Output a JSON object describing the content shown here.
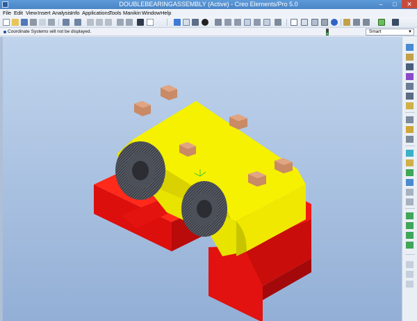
{
  "window": {
    "title": "DOUBLEBEARINGASSEMBLY (Active) - Creo Elements/Pro 5.0",
    "minimize": "–",
    "maximize": "□",
    "close": "✕"
  },
  "menu": [
    "File",
    "Edit",
    "View",
    "Insert",
    "Analysis",
    "Info",
    "Applications",
    "Tools",
    "Manikin",
    "Window",
    "Help"
  ],
  "status": {
    "message": "Coordinate Systems will not be displayed.",
    "filter_value": "Smart",
    "filter_arrow": "▼"
  },
  "toolbar_icons": [
    "new-icon",
    "open-icon",
    "save-icon",
    "print-icon",
    "email-icon",
    "copy-icon",
    "undo-icon",
    "redo-icon",
    "cut-icon",
    "copy-icon",
    "paste-icon",
    "paste-special-icon",
    "regenerate-icon",
    "find-icon",
    "select-box-icon",
    "repaint-icon",
    "refit-icon",
    "orient-icon",
    "shading-icon",
    "spin-center-icon",
    "zoom-in-icon",
    "zoom-out-icon",
    "refit-view-icon",
    "reorient-icon",
    "saved-views-icon",
    "layers-icon",
    "wireframe-icon",
    "hidden-line-icon",
    "no-hidden-icon",
    "shaded-icon",
    "enhanced-realism-icon",
    "datum-planes-icon",
    "datum-axes-icon",
    "datum-points-icon",
    "coordinate-systems-icon",
    "context-help-icon"
  ],
  "rightbar_icons": [
    "datum-plane-icon",
    "datum-axis-icon",
    "sketch-icon",
    "datum-curve-icon",
    "datum-point-icon",
    "coordinate-system-icon",
    "analysis-icon",
    "add-component-icon",
    "create-component-icon",
    "package-icon",
    "repeat-icon",
    "assemble-icon",
    "mirror-icon",
    "pattern-icon",
    "cut-icon",
    "hole-icon",
    "round-icon",
    "chamfer-icon",
    "shell-icon",
    "draft-icon",
    "rib-icon",
    "sweep-icon",
    "blend-icon"
  ],
  "colors": {
    "base_red": "#e0100f",
    "cap_yellow": "#f2ee00",
    "bolt_copper": "#c98a66",
    "bearing_dark": "#3c3f46",
    "viewport_top": "#c0d4ec",
    "viewport_bottom": "#93afd6"
  }
}
